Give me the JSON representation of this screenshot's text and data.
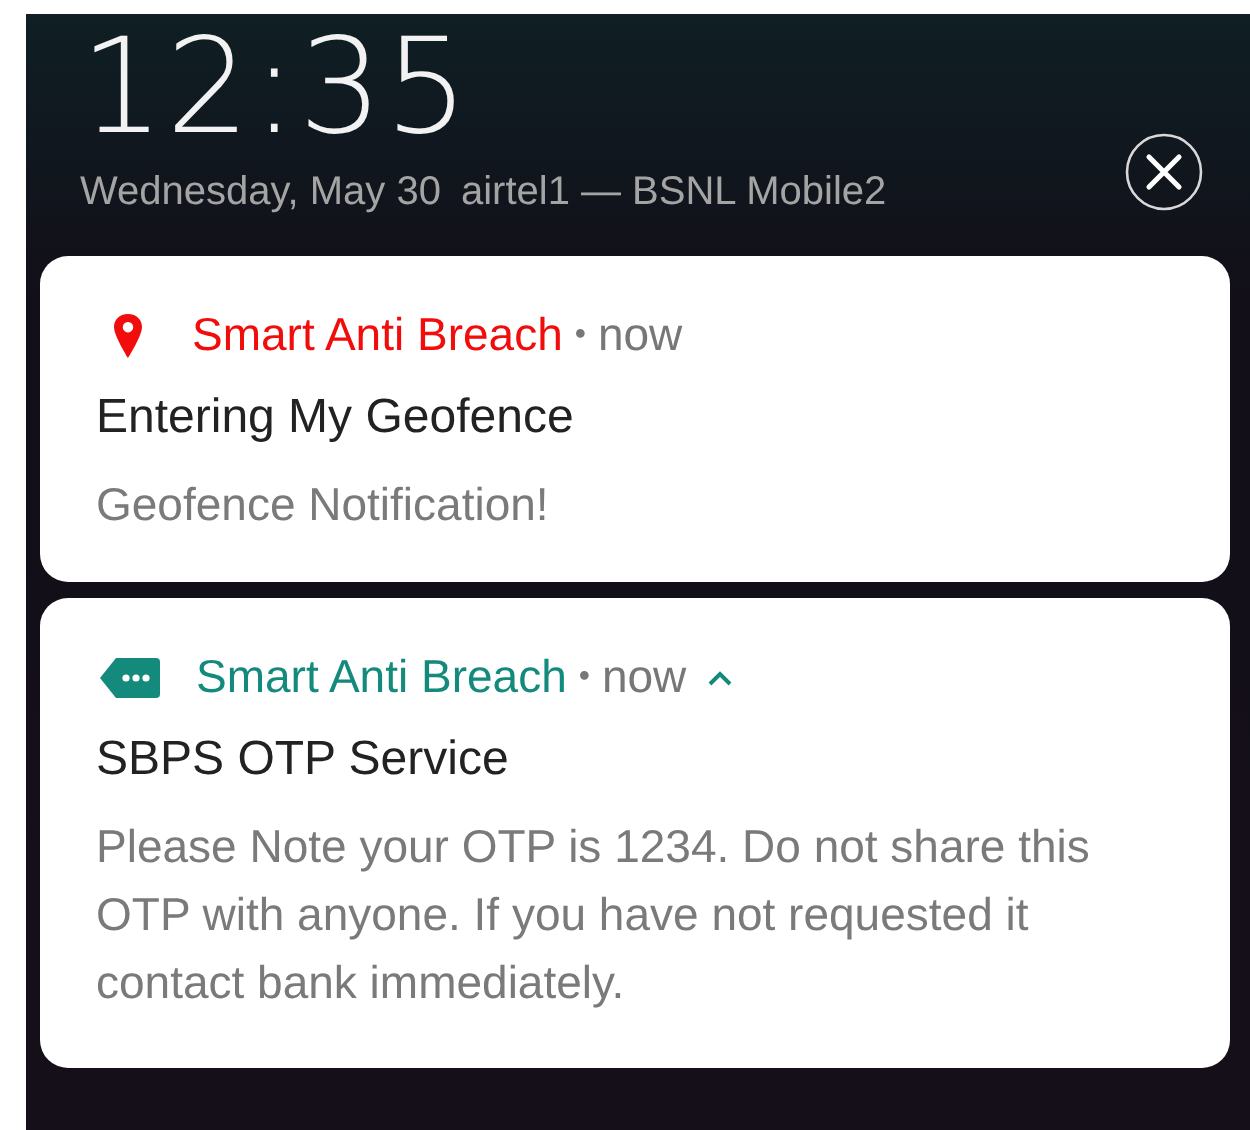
{
  "lock_screen": {
    "time": "12:35",
    "date": "Wednesday, May 30",
    "carriers": "airtel1 — BSNL Mobile2"
  },
  "notifications": [
    {
      "kind": "pin",
      "color": "#f20d0d",
      "app": "Smart Anti Breach",
      "separator": "•",
      "when": "now",
      "title": "Entering My Geofence",
      "body": "Geofence Notification!"
    },
    {
      "kind": "message",
      "color": "#138a7c",
      "app": "Smart Anti Breach",
      "separator": "•",
      "when": "now",
      "expanded": true,
      "title": "SBPS OTP Service",
      "body": "Please Note your OTP is 1234. Do not share this OTP with anyone. If you have not requested it contact bank immediately."
    }
  ]
}
